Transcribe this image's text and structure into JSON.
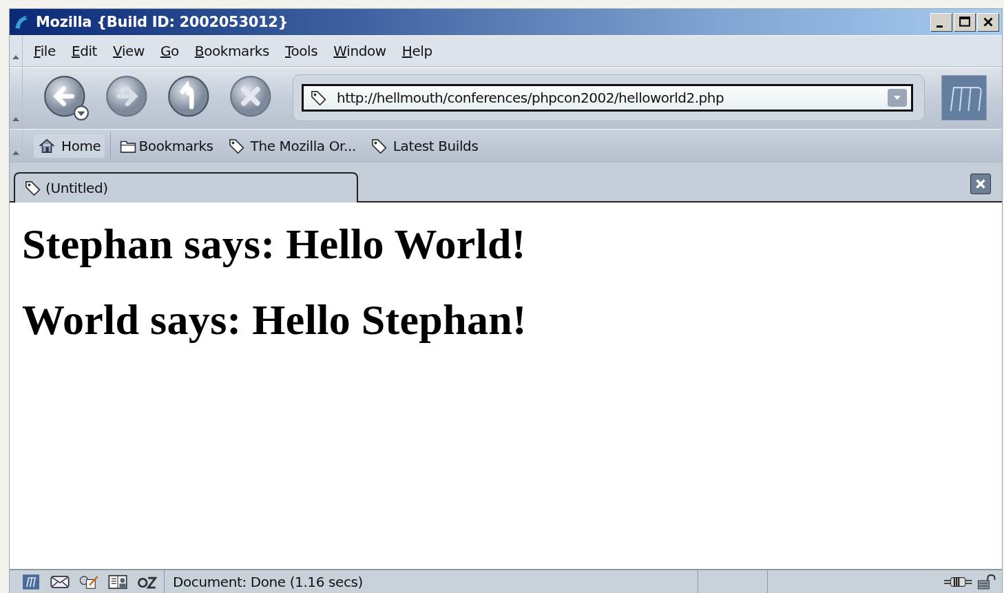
{
  "window": {
    "title": "Mozilla {Build ID: 2002053012}"
  },
  "menu": [
    "File",
    "Edit",
    "View",
    "Go",
    "Bookmarks",
    "Tools",
    "Window",
    "Help"
  ],
  "navigation": {
    "url": "http://hellmouth/conferences/phpcon2002/helloworld2.php"
  },
  "personal_toolbar": [
    {
      "label": "Home",
      "kind": "home"
    },
    {
      "label": "Bookmarks",
      "kind": "folder"
    },
    {
      "label": "The Mozilla Or...",
      "kind": "bookmark"
    },
    {
      "label": "Latest Builds",
      "kind": "bookmark"
    }
  ],
  "tabs": [
    {
      "label": "(Untitled)",
      "selected": true
    }
  ],
  "content": {
    "headings": [
      "Stephan says: Hello World!",
      "World says: Hello Stephan!"
    ]
  },
  "status_bar": {
    "text": "Document: Done (1.16 secs)"
  }
}
